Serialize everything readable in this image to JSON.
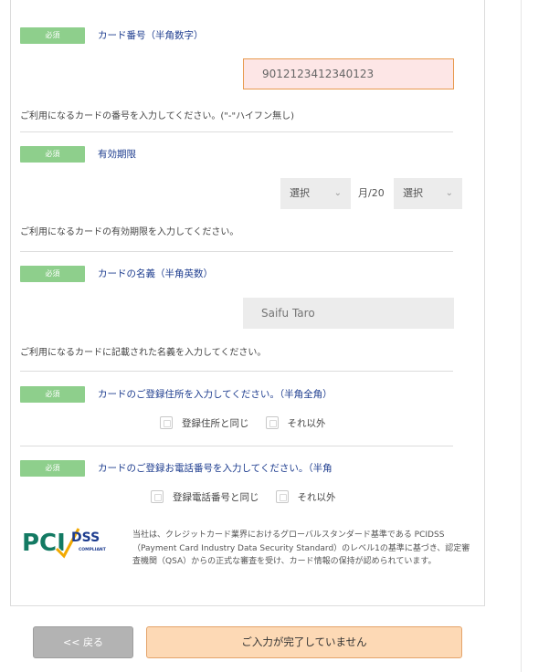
{
  "card_number": {
    "badge": "必須",
    "title": "カード番号（半角数字）",
    "value": "9012123412340123",
    "hint": "ご利用になるカードの番号を入力してください。(\"-\"ハイフン無し)"
  },
  "expiry": {
    "badge": "必須",
    "title": "有効期限",
    "month_select": "選択",
    "month_sep": "月/20",
    "year_select": "選択",
    "hint": "ご利用になるカードの有効期限を入力してください。"
  },
  "card_name": {
    "badge": "必須",
    "title": "カードの名義（半角英数）",
    "placeholder": "Saifu Taro",
    "hint": "ご利用になるカードに記載された名義を入力してください。"
  },
  "address": {
    "badge": "必須",
    "title": "カードのご登録住所を入力してください。（半角全角）",
    "option_same": "登録住所と同じ",
    "option_other": "それ以外"
  },
  "phone": {
    "badge": "必須",
    "title": "カードのご登録お電話番号を入力してください。（半角",
    "option_same": "登録電話番号と同じ",
    "option_other": "それ以外"
  },
  "pci": {
    "logo_text": "PCI DSS COMPLIANT",
    "description": "当社は、クレジットカード業界におけるグローバルスタンダード基準である PCIDSS（Payment Card Industry Data Security Standard）のレベル1の基準に基づき、認定審査機関（QSA）からの正式な審査を受け、カード情報の保持が認められています。"
  },
  "buttons": {
    "back": "<< 戻る",
    "submit": "ご入力が完了していません"
  }
}
